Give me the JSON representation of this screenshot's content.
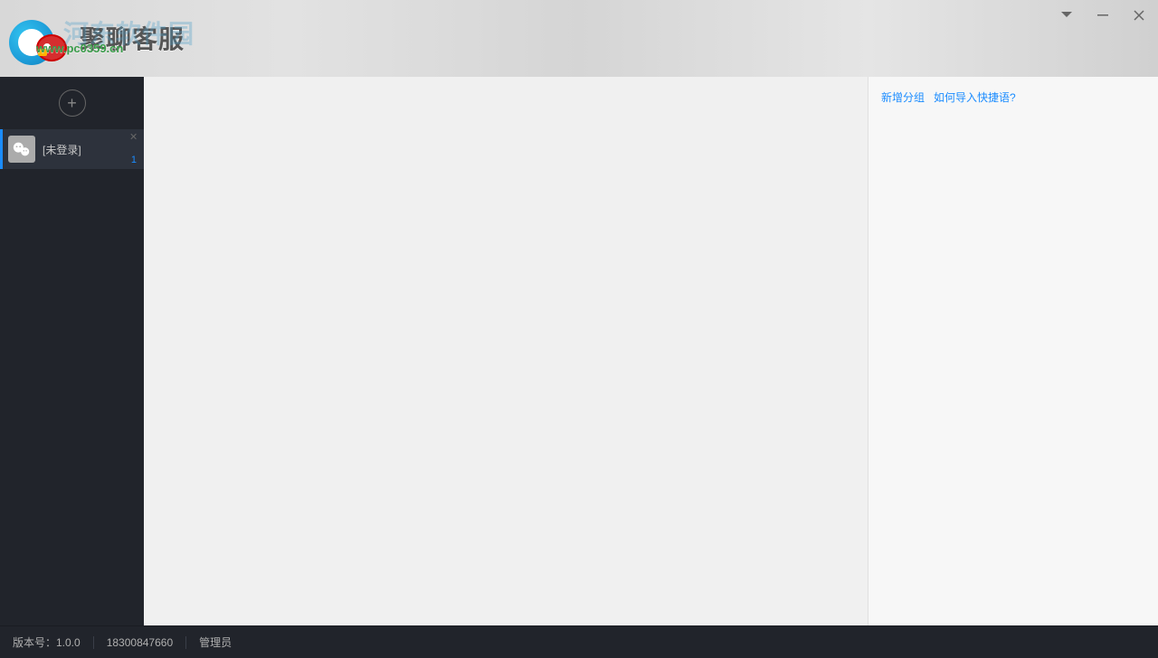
{
  "header": {
    "title": "聚聊客服",
    "watermark_text": "www.pc0359.cn",
    "bg_watermark": "河东软件园"
  },
  "win_controls": {
    "menu_icon": "menu-icon",
    "minimize_icon": "minimize-icon",
    "close_icon": "close-icon"
  },
  "sidebar": {
    "add_label": "+",
    "accounts": [
      {
        "label": "[未登录]",
        "badge": "1"
      }
    ]
  },
  "right_panel": {
    "links": [
      "新增分组",
      "如何导入快捷语?"
    ]
  },
  "statusbar": {
    "version_label": "版本号：1.0.0",
    "session_id": "18300847660",
    "user_role": "管理员"
  },
  "colors": {
    "accent": "#1b8cff",
    "sidebar_bg": "#21242b",
    "link_color": "#1b8cff"
  }
}
